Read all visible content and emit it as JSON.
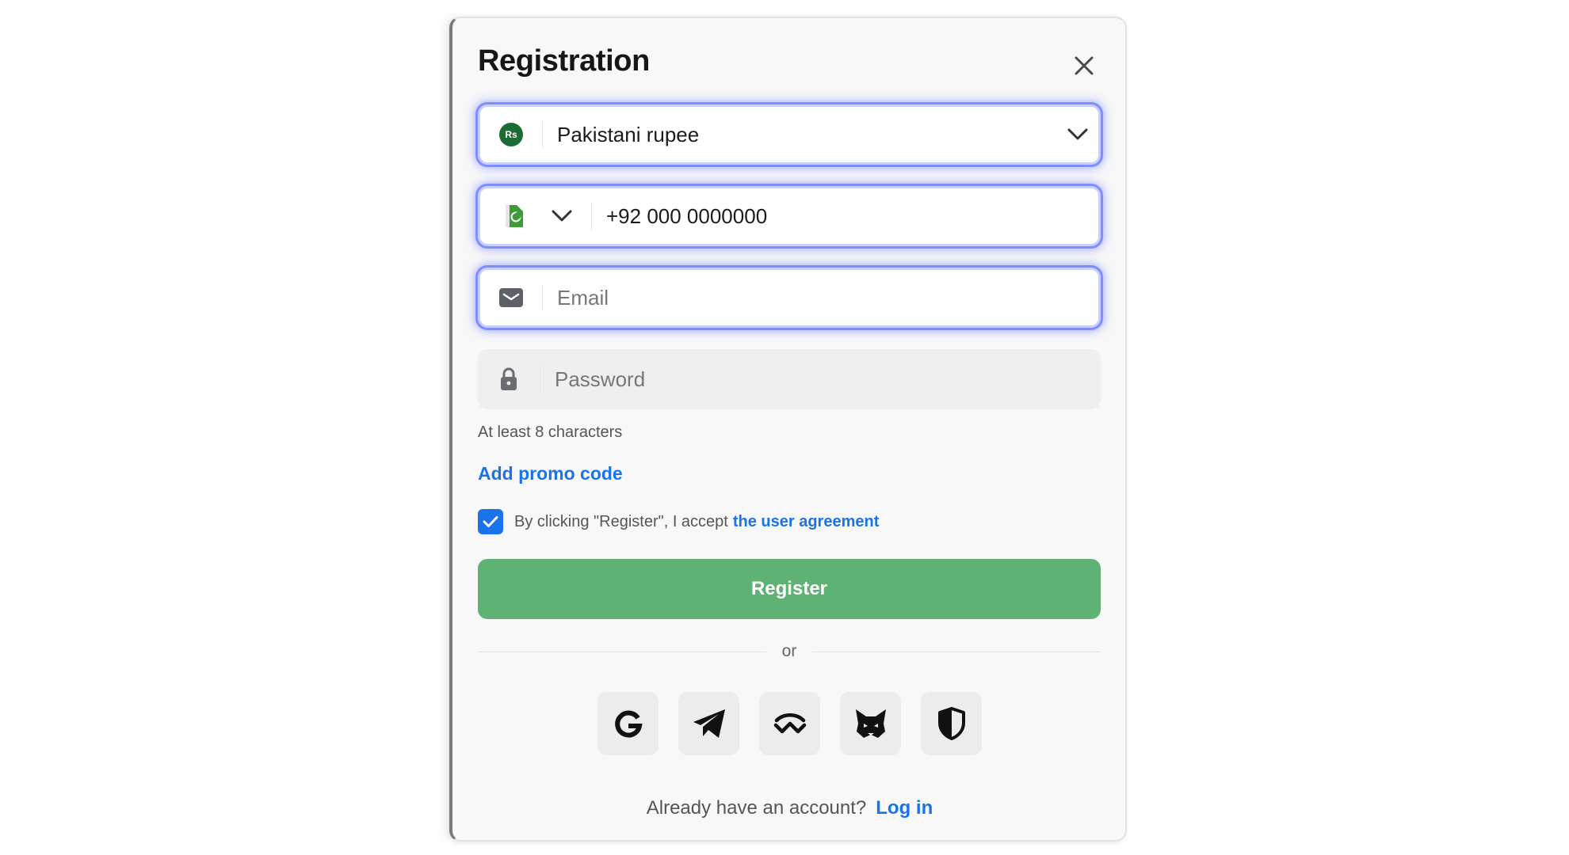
{
  "modal": {
    "title": "Registration",
    "close_icon": "close-icon"
  },
  "currency": {
    "badge": "Rs",
    "value": "Pakistani rupee",
    "badge_color": "#1f6b35"
  },
  "phone": {
    "value": "+92 000 0000000",
    "flag_icon": "pakistan-flag-icon"
  },
  "email": {
    "placeholder": "Email",
    "icon": "envelope-icon"
  },
  "password": {
    "placeholder": "Password",
    "icon": "lock-icon",
    "hint": "At least 8 characters"
  },
  "promo": {
    "label": "Add promo code"
  },
  "agreement": {
    "checked": true,
    "text": "By clicking \"Register\", I accept",
    "link": "the user agreement"
  },
  "register": {
    "label": "Register",
    "color": "#5eb273"
  },
  "divider": {
    "label": "or"
  },
  "socials": [
    {
      "name": "google-icon"
    },
    {
      "name": "telegram-icon"
    },
    {
      "name": "walletconnect-icon"
    },
    {
      "name": "metamask-icon"
    },
    {
      "name": "shield-icon"
    }
  ],
  "footer": {
    "question": "Already have an account?",
    "login": "Log in"
  },
  "colors": {
    "accent": "#1a73e8",
    "focus_ring": "#7f8dff"
  }
}
